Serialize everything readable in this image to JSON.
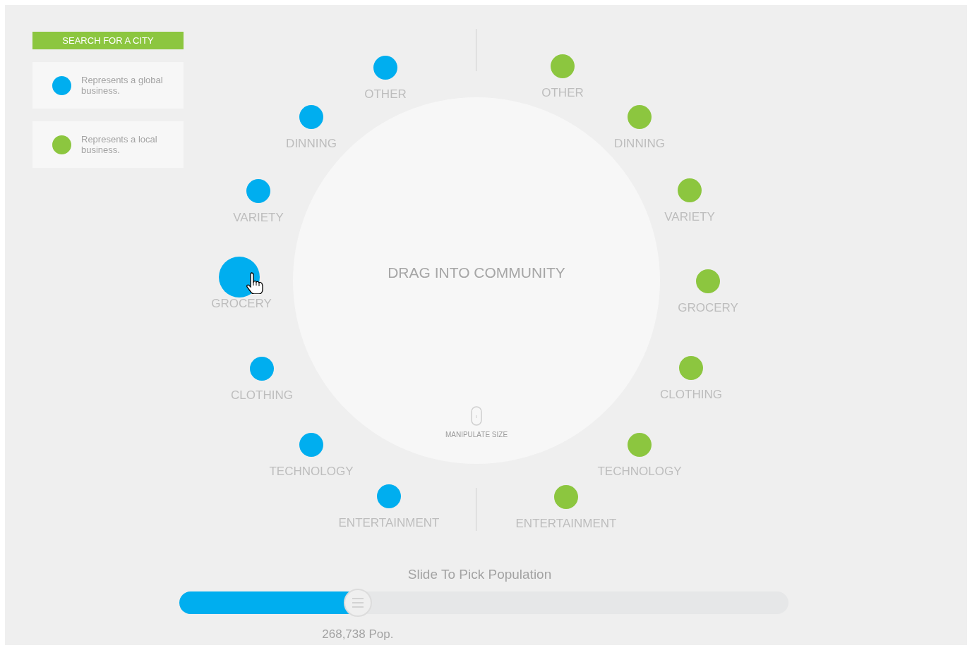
{
  "search_button": "SEARCH FOR A CITY",
  "legend": [
    {
      "text": "Represents a global business.",
      "color": "#00aeef"
    },
    {
      "text": "Represents a local business.",
      "color": "#8cc63f"
    }
  ],
  "global_businesses": {
    "color": "#00aeef",
    "items": [
      {
        "label": "OTHER",
        "selected": false
      },
      {
        "label": "DINNING",
        "selected": false
      },
      {
        "label": "VARIETY",
        "selected": false
      },
      {
        "label": "GROCERY",
        "selected": true
      },
      {
        "label": "CLOTHING",
        "selected": false
      },
      {
        "label": "TECHNOLOGY",
        "selected": false
      },
      {
        "label": "ENTERTAINMENT",
        "selected": false
      }
    ]
  },
  "local_businesses": {
    "color": "#8cc63f",
    "items": [
      {
        "label": "OTHER",
        "selected": false
      },
      {
        "label": "DINNING",
        "selected": false
      },
      {
        "label": "VARIETY",
        "selected": false
      },
      {
        "label": "GROCERY",
        "selected": false
      },
      {
        "label": "CLOTHING",
        "selected": false
      },
      {
        "label": "TECHNOLOGY",
        "selected": false
      },
      {
        "label": "ENTERTAINMENT",
        "selected": false
      }
    ]
  },
  "community": {
    "title": "DRAG INTO COMMUNITY",
    "hint": "MANIPULATE SIZE"
  },
  "slider": {
    "title": "Slide To Pick Population",
    "level": 0.293,
    "reading": "268,738 Pop."
  }
}
